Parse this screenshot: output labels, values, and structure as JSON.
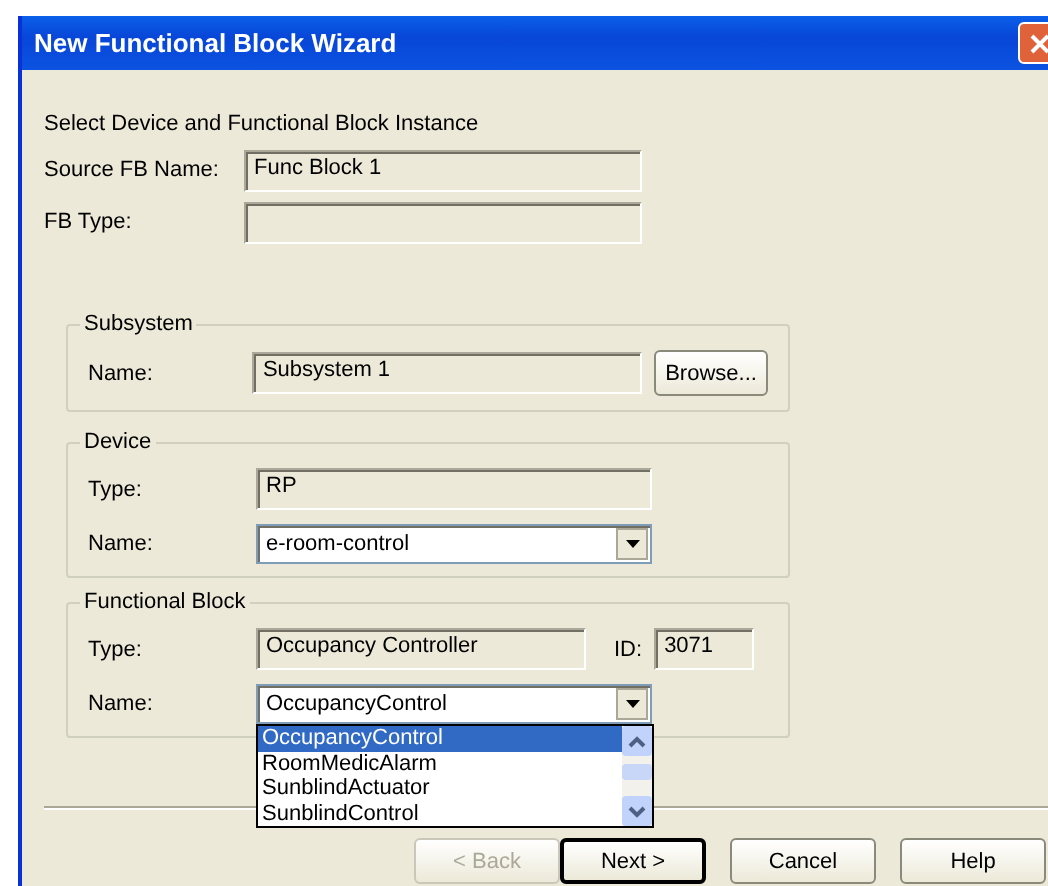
{
  "window": {
    "title": "New Functional Block Wizard"
  },
  "heading": "Select Device and Functional Block Instance",
  "source_fields": [
    {
      "label": "Source FB Name:",
      "value": "Func Block 1"
    },
    {
      "label": "FB Type:"
    }
  ],
  "subsystem": {
    "title": "Subsystem",
    "name_label": "Name:",
    "name_value": "Subsystem 1",
    "browse_button": "Browse..."
  },
  "device": {
    "title": "Device",
    "type_label": "Type:",
    "type_value": "RP",
    "name_label": "Name:",
    "name_value": "e-room-control"
  },
  "functional_block": {
    "title": "Functional Block",
    "type_label": "Type:",
    "type_value": "Occupancy Controller",
    "id_label": "ID:",
    "id_value": "3071",
    "name_label": "Name:",
    "name_value": "OccupancyControl",
    "dropdown_options": [
      {
        "label": "OccupancyControl",
        "selected": true
      },
      {
        "label": "RoomMedicAlarm",
        "selected": false
      },
      {
        "label": "SunblindActuator",
        "selected": false
      },
      {
        "label": "SunblindControl",
        "selected": false
      }
    ]
  },
  "buttons": [
    {
      "label": "< Back",
      "disabled": true,
      "default": false
    },
    {
      "label": "Next >",
      "disabled": false,
      "default": true
    },
    {
      "label": "Cancel",
      "disabled": false,
      "default": false
    },
    {
      "label": "Help",
      "disabled": false,
      "default": false
    }
  ]
}
